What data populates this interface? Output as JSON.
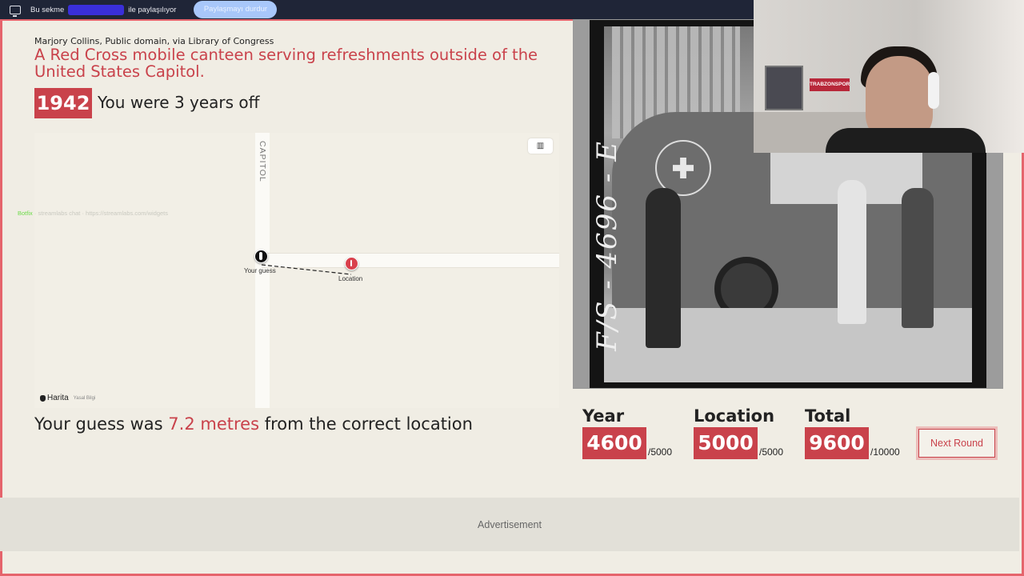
{
  "share_bar": {
    "prefix": "Bu sekme",
    "shared_name": "",
    "suffix": "ile paylaşılıyor",
    "stop_label": "Paylaşmayı durdur"
  },
  "photo": {
    "credit": "Marjory Collins, Public domain, via Library of Congress",
    "title": "A Red Cross mobile canteen serving refreshments outside of the United States Capitol.",
    "film_code": "F/S - 4696 - E"
  },
  "year_result": {
    "correct_year": "1942",
    "message": "You were 3 years off"
  },
  "map": {
    "street_label": "CAPITOL",
    "guess_label": "Your guess",
    "location_label": "Location",
    "attribution": "Harita",
    "legal": "Yasal Bilgi"
  },
  "distance_result": {
    "prefix": "Your guess was",
    "distance": "7.2 metres",
    "suffix": "from the correct location"
  },
  "scores": {
    "year": {
      "label": "Year",
      "value": "4600",
      "max": "/5000"
    },
    "location": {
      "label": "Location",
      "value": "5000",
      "max": "/5000"
    },
    "total": {
      "label": "Total",
      "value": "9600",
      "max": "/10000"
    }
  },
  "next_round_label": "Next Round",
  "advertisement_label": "Advertisement",
  "webcam": {
    "sign_text": "TRABZONSPOR"
  },
  "overlay": {
    "brand": "Botfix",
    "text": "· streamlabs chat · https://streamlabs.com/widgets"
  },
  "colors": {
    "accent": "#c9424b",
    "border": "#e5646c",
    "background": "#f0ede4"
  }
}
